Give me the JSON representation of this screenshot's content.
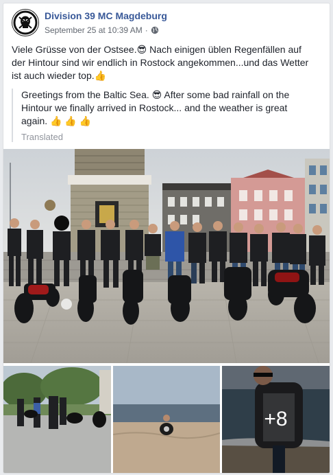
{
  "post": {
    "page_name": "Division 39 MC Magdeburg",
    "timestamp": "September 25 at 10:39 AM",
    "separator": "·",
    "privacy_icon": "globe-icon",
    "original_text_line1": "Viele Grüsse von der Ostsee.😎 Nach einigen üblen Regenfällen auf",
    "original_text_line2": "der Hintour sind wir endlich in Rostock angekommen...und das Wetter",
    "original_text_line3": "ist auch wieder top.👍",
    "translation_line1": "Greetings from the Baltic Sea. 😎 After some bad rainfall on the",
    "translation_line2": "Hintour we finally arrived in Rostock... and the weather is great",
    "translation_line3": "again. 👍 👍 👍",
    "translated_label": "Translated"
  },
  "photos": {
    "more_count": "+8"
  },
  "colors": {
    "link_blue": "#385898",
    "meta_gray": "#616770",
    "background": "#e9ebee"
  }
}
